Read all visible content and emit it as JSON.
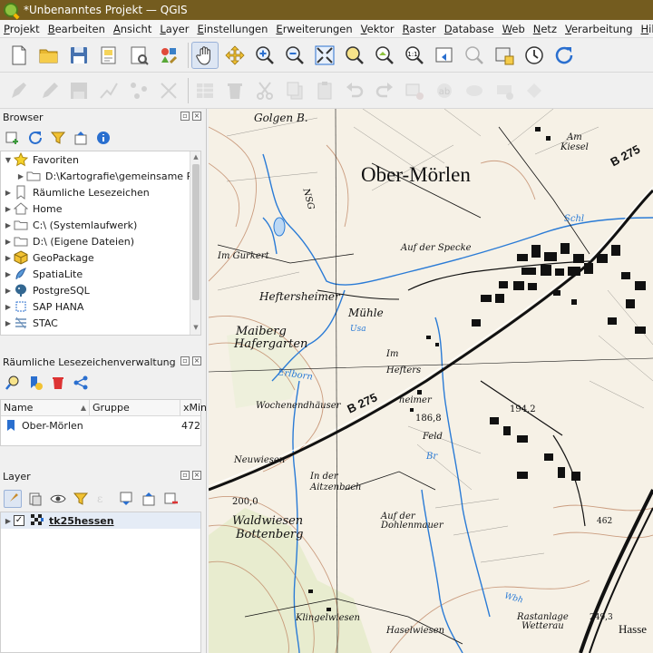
{
  "window": {
    "title": "*Unbenanntes Projekt — QGIS"
  },
  "menu": [
    {
      "label": "Projekt",
      "ul": "P",
      "rest": "rojekt"
    },
    {
      "label": "Bearbeiten",
      "ul": "B",
      "rest": "earbeiten"
    },
    {
      "label": "Ansicht",
      "ul": "A",
      "rest": "nsicht"
    },
    {
      "label": "Layer",
      "ul": "L",
      "rest": "ayer"
    },
    {
      "label": "Einstellungen",
      "ul": "E",
      "rest": "instellungen"
    },
    {
      "label": "Erweiterungen",
      "ul": "E",
      "rest": "rweiterungen"
    },
    {
      "label": "Vektor",
      "ul": "V",
      "rest": "ektor"
    },
    {
      "label": "Raster",
      "ul": "R",
      "rest": "aster"
    },
    {
      "label": "Database",
      "ul": "D",
      "rest": "atabase"
    },
    {
      "label": "Web",
      "ul": "W",
      "rest": "eb"
    },
    {
      "label": "Netz",
      "ul": "N",
      "rest": "etz"
    },
    {
      "label": "Verarbeitung",
      "ul": "V",
      "rest": "erarbeitung"
    },
    {
      "label": "Hilfe",
      "ul": "H",
      "rest": "ilfe"
    }
  ],
  "browser": {
    "title": "Browser",
    "items": [
      {
        "label": "Favoriten",
        "icon": "star-icon",
        "expanded": true,
        "level": 0
      },
      {
        "label": "D:\\Kartografie\\gemeinsame Res",
        "icon": "folder-icon",
        "level": 1
      },
      {
        "label": "Räumliche Lesezeichen",
        "icon": "bookmark-icon",
        "level": 0
      },
      {
        "label": "Home",
        "icon": "home-icon",
        "level": 0
      },
      {
        "label": "C:\\ (Systemlaufwerk)",
        "icon": "folder-icon",
        "level": 0
      },
      {
        "label": "D:\\ (Eigene Dateien)",
        "icon": "folder-icon",
        "level": 0
      },
      {
        "label": "GeoPackage",
        "icon": "geopackage-icon",
        "level": 0
      },
      {
        "label": "SpatiaLite",
        "icon": "spatialite-icon",
        "level": 0
      },
      {
        "label": "PostgreSQL",
        "icon": "postgresql-icon",
        "level": 0
      },
      {
        "label": "SAP HANA",
        "icon": "sap-hana-icon",
        "level": 0
      },
      {
        "label": "STAC",
        "icon": "stac-icon",
        "level": 0
      }
    ]
  },
  "bookmarks": {
    "title": "Räumliche Lesezeichenverwaltung",
    "columns": [
      "Name",
      "Gruppe",
      "xMin"
    ],
    "rows": [
      {
        "name": "Ober-Mörlen",
        "group": "",
        "xmin": "472"
      }
    ]
  },
  "layers": {
    "title": "Layer",
    "items": [
      {
        "name": "tk25hessen",
        "checked": true
      }
    ]
  },
  "map": {
    "labels": {
      "town": "Ober-Mörlen",
      "golgen": "Golgen B.",
      "am_kiesel": "Am\nKiesel",
      "b275_top": "B 275",
      "b275_mid": "B 275",
      "nsg": "NSG",
      "auf_der_specke": "Auf der Specke",
      "im_gurkert": "Im Gurkert",
      "heftersheimer": "Heftersheimer",
      "muhle": "Mühle",
      "usa": "Usa",
      "maiberg": "Maiberg",
      "hafergarten": "Hafergarten",
      "im_hefters": "Im\nHefters",
      "erlborn": "Erlborn",
      "wochenendhauser": "Wochenendhäuser",
      "heimer": "heimer",
      "feld": "Feld",
      "height_1868": "186,8",
      "height_1942": "194,2",
      "neuwiesen": "Neuwiesen",
      "in_der_aitzenbach": "In der\nAitzenbach",
      "height_2000": "200,0",
      "waldwiesen": "Waldwiesen",
      "bottenberg": "Bottenberg",
      "auf_der_dohlenmauer": "Auf der\nDohlenmauer",
      "height_462": "462",
      "klingelwiesen": "Klingelwiesen",
      "haselwiesen": "Haselwiesen",
      "wbh": "Wbh",
      "rastanlage": "Rastanlage\nWetterau",
      "hasse": "Hasse",
      "height_2493": "249,3",
      "schl": "Schl",
      "br": "Br"
    }
  }
}
